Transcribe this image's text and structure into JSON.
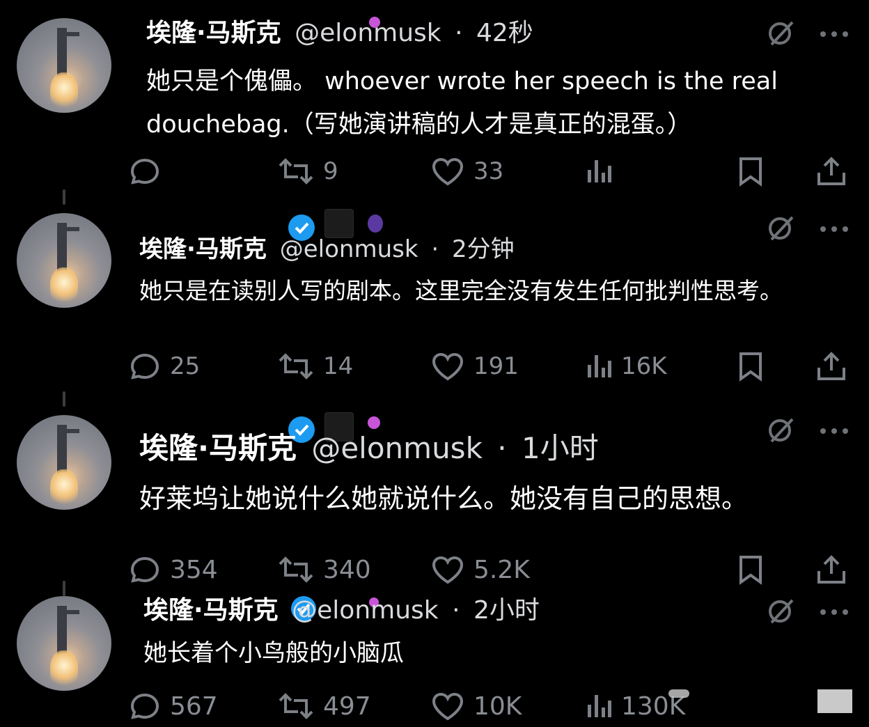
{
  "posts": [
    {
      "name": "埃隆·马斯克",
      "handle": "@elonmusk",
      "sep": "·",
      "time": "42秒",
      "text_lines": [
        "她只是个傀儡。 whoever wrote her speech is the real",
        "douchebag.（写她演讲稿的人才是真正的混蛋。）"
      ],
      "replies": "",
      "reposts": "9",
      "likes": "33",
      "views": ""
    },
    {
      "name": "埃隆·马斯克",
      "handle": "@elonmusk",
      "sep": "·",
      "time": "2分钟",
      "text_lines": [
        "她只是在读别人写的剧本。这里完全没有发生任何批判性思考。"
      ],
      "replies": "25",
      "reposts": "14",
      "likes": "191",
      "views": "16K"
    },
    {
      "name": "埃隆·马斯克",
      "handle": "@elonmusk",
      "sep": "·",
      "time": "1小时",
      "text_lines": [
        "好莱坞让她说什么她就说什么。她没有自己的思想。"
      ],
      "replies": "354",
      "reposts": "340",
      "likes": "5.2K",
      "views": ""
    },
    {
      "name": "埃隆·马斯克",
      "handle": "@elonmusk",
      "sep": "·",
      "time": "2小时",
      "text_lines": [
        "她长着个小鸟般的小脑瓜"
      ],
      "replies": "567",
      "reposts": "497",
      "likes": "10K",
      "views": "130K"
    }
  ],
  "icons": {
    "reply": "reply-icon",
    "repost": "repost-icon",
    "like": "like-icon",
    "views": "views-icon",
    "bookmark": "bookmark-icon",
    "share": "share-icon",
    "grok": "grok-icon",
    "more": "more-icon",
    "verified": "verified-badge-icon"
  },
  "colors": {
    "background": "#000000",
    "text": "#ffffff",
    "muted": "#7d8187",
    "verified": "#1d9bf0",
    "accent_pink": "#c855d8"
  }
}
